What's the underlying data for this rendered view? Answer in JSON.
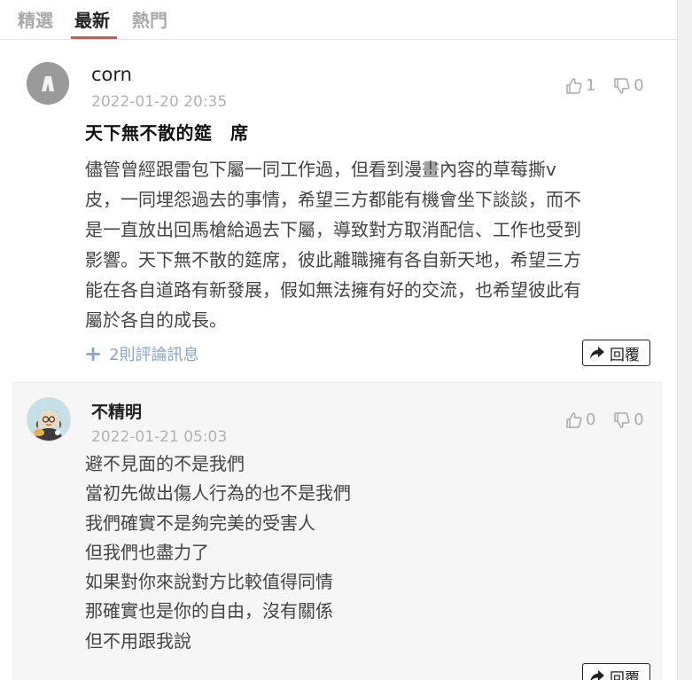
{
  "tabs": [
    {
      "label": "精選",
      "active": false
    },
    {
      "label": "最新",
      "active": true
    },
    {
      "label": "熱門",
      "active": false
    }
  ],
  "accent_color": "#d9534f",
  "comments": [
    {
      "username": "corn",
      "timestamp": "2022-01-20 20:35",
      "likes": "1",
      "dislikes": "0",
      "title": "天下無不散的筵　席",
      "body_lines": [
        "儘管曾經跟雷包下屬一同工作過，但看到漫畫內容的草莓撕v",
        "皮，一同埋怨過去的事情，希望三方都能有機會坐下談談，而不",
        "是一直放出回馬槍給過去下屬，導致對方取消配信、工作也受到",
        "影響。天下無不散的筵席，彼此離職擁有各自新天地，希望三方",
        "能在各自道路有新發展，假如無法擁有好的交流，也希望彼此有",
        "屬於各自的成長。"
      ],
      "replies_label": "2則評論訊息",
      "reply_label": "回覆"
    },
    {
      "username": "不精明",
      "timestamp": "2022-01-21 05:03",
      "likes": "0",
      "dislikes": "0",
      "body_lines": [
        "避不見面的不是我們",
        "當初先做出傷人行為的也不是我們",
        "我們確實不是夠完美的受害人",
        "但我們也盡力了",
        "如果對你來說對方比較值得同情",
        "那確實也是你的自由，沒有關係",
        "但不用跟我說"
      ],
      "reply_label": "回覆"
    }
  ]
}
